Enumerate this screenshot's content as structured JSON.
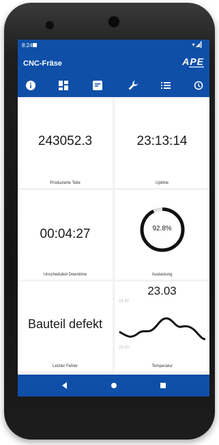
{
  "status_bar": {
    "time": "8:24",
    "right_icons": "▾◢▎"
  },
  "app_bar": {
    "title": "CNC-Fräse",
    "logo_text": "APE"
  },
  "tabs": [
    {
      "icon": "info-icon"
    },
    {
      "icon": "dashboard-icon"
    },
    {
      "icon": "edit-icon"
    },
    {
      "icon": "wrench-icon"
    },
    {
      "icon": "list-icon"
    },
    {
      "icon": "history-icon"
    }
  ],
  "tiles": {
    "produced_parts": {
      "value": "243052.3",
      "label": "Produzierte Teile"
    },
    "uptime": {
      "value": "23:13:14",
      "label": "Uptime"
    },
    "unscheduled_downtime": {
      "value": "00:04:27",
      "label": "Unscheduled Downtime"
    },
    "utilization": {
      "value": "92.8%",
      "label": "Auslastung",
      "fraction": 0.928
    },
    "last_error": {
      "value": "Bauteil defekt",
      "label": "Letzter Fehler"
    },
    "temperature": {
      "value": "23.03",
      "label": "Temperatur",
      "axis_max": "23.40",
      "axis_min": "23.00"
    }
  },
  "nav": {
    "back": "back-icon",
    "home": "home-icon",
    "recents": "recents-icon"
  },
  "colors": {
    "primary": "#0f4fa8",
    "tile": "#ffffff",
    "background": "#f2f2f2"
  }
}
